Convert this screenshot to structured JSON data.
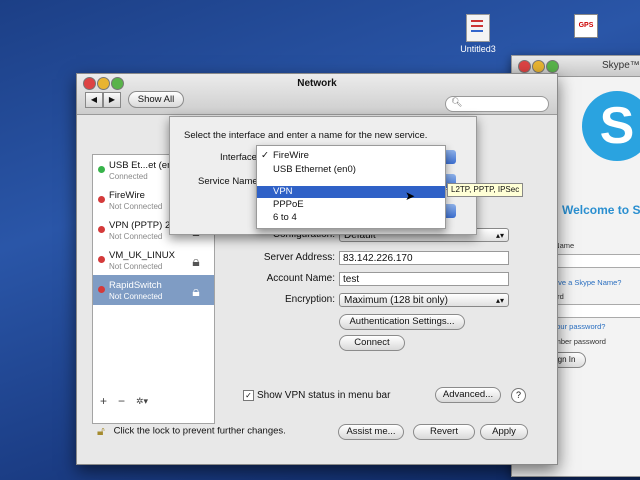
{
  "desktop": {
    "icons": [
      {
        "label": "Untitled3"
      },
      {
        "label": "GPS"
      }
    ]
  },
  "skype": {
    "title": "Skype™",
    "logo": "S",
    "welcome": "Welcome to S",
    "skype_name_label": "ype Name",
    "no_name_link": "n't have a Skype Name?",
    "password_label": "ssword",
    "forgot_link": "got your password?",
    "remember": "emember password",
    "sign_in": "Sign In"
  },
  "window": {
    "title": "Network",
    "show_all": "Show All",
    "search_icon": "magnifier-icon"
  },
  "sidebar": {
    "items": [
      {
        "name": "USB Et...et (en",
        "status": "Connected",
        "dot": "#37b34a"
      },
      {
        "name": "FireWire",
        "status": "Not Connected",
        "dot": "#d43a3a"
      },
      {
        "name": "VPN (PPTP) 2",
        "status": "Not Connected",
        "dot": "#d43a3a"
      },
      {
        "name": "VM_UK_LINUX",
        "status": "Not Connected",
        "dot": "#d43a3a"
      },
      {
        "name": "RapidSwitch",
        "status": "Not Connected",
        "dot": "#d43a3a"
      }
    ],
    "add": "+",
    "remove": "−",
    "action": "✲▾"
  },
  "form": {
    "configuration_label": "Configuration:",
    "configuration_value": "Default",
    "server_label": "Server Address:",
    "server_value": "83.142.226.170",
    "account_label": "Account Name:",
    "account_value": "test",
    "encryption_label": "Encryption:",
    "encryption_value": "Maximum (128 bit only)",
    "auth_button": "Authentication Settings...",
    "connect_button": "Connect",
    "show_vpn_status": "Show VPN status in menu bar",
    "advanced_button": "Advanced...",
    "help": "?"
  },
  "footer": {
    "lock_text": "Click the lock to prevent further changes.",
    "assist": "Assist me...",
    "revert": "Revert",
    "apply": "Apply"
  },
  "sheet": {
    "instruction": "Select the interface and enter a name for the new service.",
    "interface_label": "Interface",
    "service_name_label": "Service Name"
  },
  "dropdown": {
    "items": [
      {
        "label": "FireWire",
        "checked": true
      },
      {
        "label": "USB Ethernet (en0)",
        "checked": false
      },
      {
        "label": "VPN",
        "checked": false,
        "highlighted": true
      },
      {
        "label": "PPPoE",
        "checked": false
      },
      {
        "label": "6 to 4",
        "checked": false
      }
    ],
    "check_mark": "✓",
    "tooltip": "L2TP, PPTP, IPSec"
  },
  "colors": {
    "selection": "#7f9cc4",
    "menu_highlight": "#2f61c7",
    "skype_blue": "#2aa3e0"
  }
}
